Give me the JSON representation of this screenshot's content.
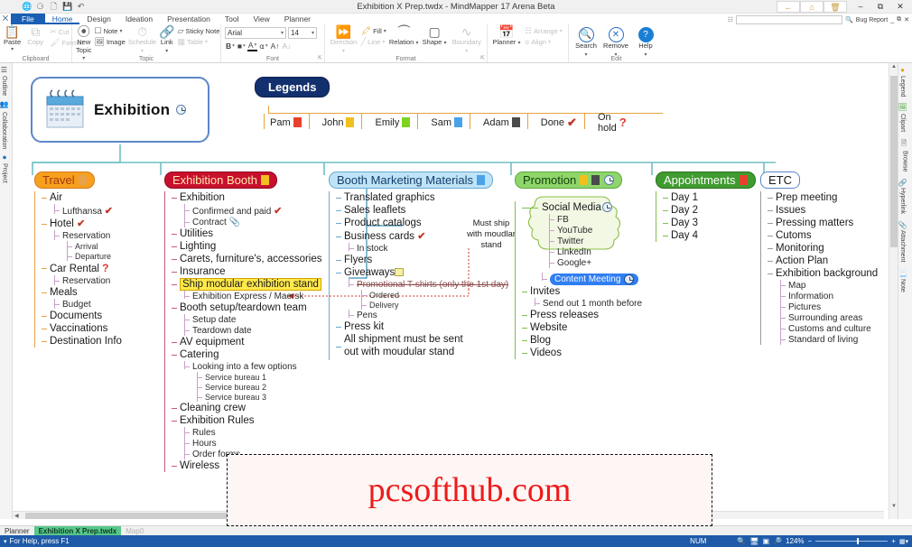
{
  "window": {
    "title": "Exhibition X Prep.twdx - MindMapper 17 Arena Beta",
    "quick_access": [
      "globe-icon",
      "minimize-ribbon-icon",
      "new-icon",
      "save-icon",
      "undo-icon"
    ],
    "web_buttons": [
      "back-icon",
      "home-icon",
      "delete-icon"
    ],
    "controls": [
      "minimize",
      "restore",
      "close"
    ],
    "second_row": {
      "search_placeholder": "",
      "bug_report": "Bug Report",
      "min": "_",
      "restore": "⧉",
      "close": "✕"
    }
  },
  "ribbon": {
    "system_menu": "⨉",
    "tabs": [
      {
        "label": "File",
        "state": "file"
      },
      {
        "label": "Home",
        "state": "active"
      },
      {
        "label": "Design",
        "state": "normal"
      },
      {
        "label": "Ideation",
        "state": "normal"
      },
      {
        "label": "Presentation",
        "state": "normal"
      },
      {
        "label": "Tool",
        "state": "normal"
      },
      {
        "label": "View",
        "state": "normal"
      },
      {
        "label": "Planner",
        "state": "normal"
      }
    ],
    "groups": [
      {
        "name": "Clipboard",
        "big": [
          {
            "label": "Paste",
            "icon": "clipboard-icon",
            "glyph": "📋",
            "disabled": false,
            "dropdown": true
          }
        ],
        "small_col1": [
          {
            "label": "",
            "icon": "copy-icon",
            "glyph": "⧉",
            "disabled": true
          }
        ],
        "small": [
          {
            "label": "Cut",
            "icon": "scissors-icon",
            "glyph": "✂",
            "disabled": true
          },
          {
            "label": "Format",
            "icon": "format-painter-icon",
            "glyph": "🖌",
            "disabled": true
          }
        ],
        "copy_label": "Copy"
      },
      {
        "name": "Topic",
        "big": [
          {
            "label": "New Topic",
            "icon": "new-topic-icon",
            "glyph": "⦿",
            "disabled": false,
            "dropdown": true
          },
          {
            "label": "Schedule",
            "icon": "clock-icon",
            "glyph": "◴",
            "disabled": true,
            "dropdown": true
          },
          {
            "label": "Link",
            "icon": "link-icon",
            "glyph": "🔗",
            "disabled": false,
            "dropdown": true
          }
        ],
        "small": [
          {
            "label": "Note",
            "icon": "note-icon",
            "glyph": "□",
            "disabled": false,
            "dropdown": true
          },
          {
            "label": "Image",
            "icon": "image-icon",
            "glyph": "🖼",
            "disabled": false
          },
          {
            "label": "Sticky Note",
            "icon": "sticky-note-icon",
            "glyph": "◱",
            "disabled": false
          },
          {
            "label": "Table",
            "icon": "table-icon",
            "glyph": "▦",
            "disabled": true,
            "dropdown": true
          }
        ]
      },
      {
        "name": "Font",
        "font_family": "Arial",
        "font_size": "14",
        "buttons": [
          "bold-icon",
          "highlight-icon",
          "font-color-icon",
          "text-effect-icon",
          "grow-font-icon",
          "shrink-font-icon"
        ]
      },
      {
        "name": "Format",
        "big": [
          {
            "label": "Direction",
            "icon": "direction-icon",
            "glyph": "⑂",
            "disabled": true,
            "dropdown": true
          },
          {
            "label": "Relation",
            "icon": "relation-icon",
            "glyph": "◜",
            "disabled": false,
            "dropdown": true
          },
          {
            "label": "Shape",
            "icon": "shape-icon",
            "glyph": "▢",
            "disabled": false,
            "dropdown": true
          },
          {
            "label": "Boundary",
            "icon": "boundary-icon",
            "glyph": "∿",
            "disabled": true,
            "dropdown": true
          }
        ],
        "small": [
          {
            "label": "Fill",
            "icon": "fill-icon",
            "glyph": "🖍",
            "disabled": false,
            "dropdown": true
          },
          {
            "label": "Line",
            "icon": "line-icon",
            "glyph": "╱",
            "disabled": true,
            "dropdown": true
          }
        ]
      },
      {
        "name": "",
        "big": [
          {
            "label": "Planner",
            "icon": "calendar-icon",
            "glyph": "📅",
            "disabled": false,
            "dropdown": true
          }
        ],
        "small": [
          {
            "label": "Arrange",
            "icon": "arrange-icon",
            "glyph": "☷",
            "disabled": true,
            "dropdown": true
          },
          {
            "label": "Align",
            "icon": "align-icon",
            "glyph": "≡",
            "disabled": true,
            "dropdown": true
          }
        ]
      },
      {
        "name": "Edit",
        "circle": [
          {
            "label": "Search",
            "icon": "search-icon",
            "glyph": "🔍",
            "dropdown": true
          },
          {
            "label": "Remove",
            "icon": "remove-icon",
            "glyph": "✕",
            "dropdown": true
          },
          {
            "label": "Help",
            "icon": "help-icon",
            "glyph": "?",
            "dropdown": true
          }
        ]
      }
    ]
  },
  "left_rail": [
    {
      "label": "Outline",
      "icon": "outline-icon"
    },
    {
      "label": "Collaboration",
      "icon": "collaboration-icon"
    },
    {
      "label": "Project",
      "icon": "project-icon"
    }
  ],
  "right_rail": [
    {
      "label": "Legend",
      "icon": "legend-icon"
    },
    {
      "label": "Clipart",
      "icon": "clipart-icon"
    },
    {
      "label": "Browse",
      "icon": "browse-icon"
    },
    {
      "label": "Hyperlink",
      "icon": "hyperlink-icon"
    },
    {
      "label": "Attachment",
      "icon": "attachment-icon"
    },
    {
      "label": "Note",
      "icon": "note-icon"
    }
  ],
  "map": {
    "central": {
      "label": "Exhibition",
      "icon": "calendar-image",
      "marker": "clock-icon"
    },
    "legends": {
      "title": "Legends",
      "items": [
        {
          "label": "Pam",
          "icon": "person-icon",
          "color": "#e8412b"
        },
        {
          "label": "John",
          "icon": "person-icon",
          "color": "#f2c01e"
        },
        {
          "label": "Emily",
          "icon": "person-icon",
          "color": "#7ed321"
        },
        {
          "label": "Sam",
          "icon": "person-icon",
          "color": "#4aa3e8"
        },
        {
          "label": "Adam",
          "icon": "person-icon",
          "color": "#4b4b4b"
        },
        {
          "label": "Done",
          "icon": "check-icon",
          "color": "#c0392b"
        },
        {
          "label": "On hold",
          "icon": "question-icon",
          "color": "#e03b2f"
        }
      ]
    },
    "branches": [
      {
        "title": "Travel",
        "head_bg": "#f7a01e",
        "head_border": "#d4791a",
        "head_color": "#a33a10",
        "markers": [
          {
            "icon": "person-icon",
            "color": "#e8a24a"
          }
        ],
        "nodes": [
          {
            "level": 1,
            "label": "Air"
          },
          {
            "level": 2,
            "label": "Lufthansa",
            "marker": "check-icon"
          },
          {
            "level": 1,
            "label": "Hotel",
            "marker": "check-icon"
          },
          {
            "level": 2,
            "label": "Reservation"
          },
          {
            "level": 3,
            "label": "Arrival"
          },
          {
            "level": 3,
            "label": "Departure"
          },
          {
            "level": 1,
            "label": "Car Rental",
            "marker": "question-icon"
          },
          {
            "level": 2,
            "label": "Reservation"
          },
          {
            "level": 1,
            "label": "Meals"
          },
          {
            "level": 2,
            "label": "Budget"
          },
          {
            "level": 1,
            "label": "Documents"
          },
          {
            "level": 1,
            "label": "Vaccinations"
          },
          {
            "level": 1,
            "label": "Destination Info"
          }
        ]
      },
      {
        "title": "Exhibition Booth",
        "head_bg": "#c8102e",
        "head_border": "#8f0a20",
        "head_color": "#ffe9b0",
        "markers": [
          {
            "icon": "person-icon",
            "color": "#f2c01e"
          }
        ],
        "nodes": [
          {
            "level": 1,
            "label": "Exhibition"
          },
          {
            "level": 2,
            "label": "Confirmed and paid",
            "marker": "check-icon"
          },
          {
            "level": 2,
            "label": "Contract",
            "marker": "attachment-icon"
          },
          {
            "level": 1,
            "label": "Utilities"
          },
          {
            "level": 1,
            "label": "Lighting"
          },
          {
            "level": 1,
            "label": "Carets, furniture's, accessories"
          },
          {
            "level": 1,
            "label": "Insurance"
          },
          {
            "level": 1,
            "label": "Ship modular exhibition stand",
            "highlight": true
          },
          {
            "level": 2,
            "label": "Exhibition Express / Maersk"
          },
          {
            "level": 1,
            "label": "Booth setup/teardown team"
          },
          {
            "level": 2,
            "label": "Setup date"
          },
          {
            "level": 2,
            "label": "Teardown date"
          },
          {
            "level": 1,
            "label": "AV equipment"
          },
          {
            "level": 1,
            "label": "Catering"
          },
          {
            "level": 2,
            "label": "Looking into a few options"
          },
          {
            "level": 3,
            "label": "Service bureau 1"
          },
          {
            "level": 3,
            "label": "Service bureau 2"
          },
          {
            "level": 3,
            "label": "Service bureau 3"
          },
          {
            "level": 1,
            "label": "Cleaning crew"
          },
          {
            "level": 1,
            "label": "Exhibition Rules"
          },
          {
            "level": 2,
            "label": "Rules"
          },
          {
            "level": 2,
            "label": "Hours"
          },
          {
            "level": 2,
            "label": "Order forms"
          },
          {
            "level": 1,
            "label": "Wireless"
          }
        ]
      },
      {
        "title": "Booth Marketing Materials",
        "head_bg": "#bfe3f7",
        "head_border": "#6aa9d4",
        "head_color": "#123f6b",
        "markers": [
          {
            "icon": "person-icon",
            "color": "#4aa3e8"
          }
        ],
        "nodes": [
          {
            "level": 1,
            "label": "Translated graphics"
          },
          {
            "level": 1,
            "label": "Sales leaflets"
          },
          {
            "level": 1,
            "label": "Product catalogs"
          },
          {
            "level": 1,
            "label": "Business cards",
            "marker": "check-icon"
          },
          {
            "level": 2,
            "label": "In stock"
          },
          {
            "level": 1,
            "label": "Flyers"
          },
          {
            "level": 1,
            "label": "Giveaways",
            "marker": "note-icon"
          },
          {
            "level": 2,
            "label": "Promotional T-shirts (only the 1st day)",
            "struck": true
          },
          {
            "level": 3,
            "label": "Ordered"
          },
          {
            "level": 3,
            "label": "Delivery"
          },
          {
            "level": 2,
            "label": "Pens"
          },
          {
            "level": 1,
            "label": "Press kit"
          },
          {
            "level": 1,
            "label": "All shipment must be sent out with moudular stand"
          }
        ],
        "callout": "Must ship with moudlar stand"
      },
      {
        "title": "Promotion",
        "head_bg": "#8ed66a",
        "head_border": "#5da83c",
        "head_color": "#16400c",
        "markers": [
          {
            "icon": "person-icon",
            "color": "#f2c01e"
          },
          {
            "icon": "person-icon",
            "color": "#4b4b4b"
          },
          {
            "icon": "clock-icon",
            "color": "#5a7fa8"
          }
        ],
        "nodes": [
          {
            "level": 1,
            "label": "Social Media",
            "marker": "clock-icon",
            "boundary": true
          },
          {
            "level": 2,
            "label": "FB"
          },
          {
            "level": 2,
            "label": "YouTube"
          },
          {
            "level": 2,
            "label": "Twitter"
          },
          {
            "level": 2,
            "label": "LinkedIn"
          },
          {
            "level": 2,
            "label": "Google+"
          },
          {
            "level": 2,
            "label": "Content Meeting",
            "marker": "clock-icon",
            "selected": true
          },
          {
            "level": 1,
            "label": "Invites"
          },
          {
            "level": 2,
            "label": "Send out 1 month before"
          },
          {
            "level": 1,
            "label": "Press releases"
          },
          {
            "level": 1,
            "label": "Website"
          },
          {
            "level": 1,
            "label": "Blog"
          },
          {
            "level": 1,
            "label": "Videos"
          }
        ]
      },
      {
        "title": "Appointments",
        "head_bg": "#3f9b2f",
        "head_border": "#2b7020",
        "head_color": "#ffffff",
        "markers": [
          {
            "icon": "person-icon",
            "color": "#e8412b"
          }
        ],
        "nodes": [
          {
            "level": 1,
            "label": "Day 1"
          },
          {
            "level": 1,
            "label": "Day 2"
          },
          {
            "level": 1,
            "label": "Day 3"
          },
          {
            "level": 1,
            "label": "Day 4"
          }
        ]
      },
      {
        "title": "ETC",
        "head_bg": "#ffffff",
        "head_border": "#5c87c8",
        "head_color": "#1a1a1a",
        "markers": [],
        "nodes": [
          {
            "level": 1,
            "label": "Prep meeting"
          },
          {
            "level": 1,
            "label": "Issues"
          },
          {
            "level": 1,
            "label": "Pressing matters"
          },
          {
            "level": 1,
            "label": "Cutoms"
          },
          {
            "level": 1,
            "label": "Monitoring"
          },
          {
            "level": 1,
            "label": "Action Plan"
          },
          {
            "level": 1,
            "label": "Exhibition background"
          },
          {
            "level": 2,
            "label": "Map"
          },
          {
            "level": 2,
            "label": "Information"
          },
          {
            "level": 2,
            "label": "Pictures"
          },
          {
            "level": 2,
            "label": "Surrounding areas"
          },
          {
            "level": 2,
            "label": "Customs and culture"
          },
          {
            "level": 2,
            "label": "Standard of living"
          }
        ]
      }
    ]
  },
  "watermark": "pcsofthub.com",
  "doc_tabs": [
    {
      "label": "Planner",
      "state": "normal"
    },
    {
      "label": "Exhibition X Prep.twdx",
      "state": "active"
    },
    {
      "label": "Map0",
      "state": "dim"
    }
  ],
  "statusbar": {
    "help": "For Help, press F1",
    "num": "NUM",
    "zoom": "124%",
    "zoom_out": "−",
    "zoom_in": "+",
    "view_icons": [
      "zoom-out-icon",
      "fit-page-icon",
      "fit-width-icon",
      "zoom-in-icon"
    ]
  }
}
